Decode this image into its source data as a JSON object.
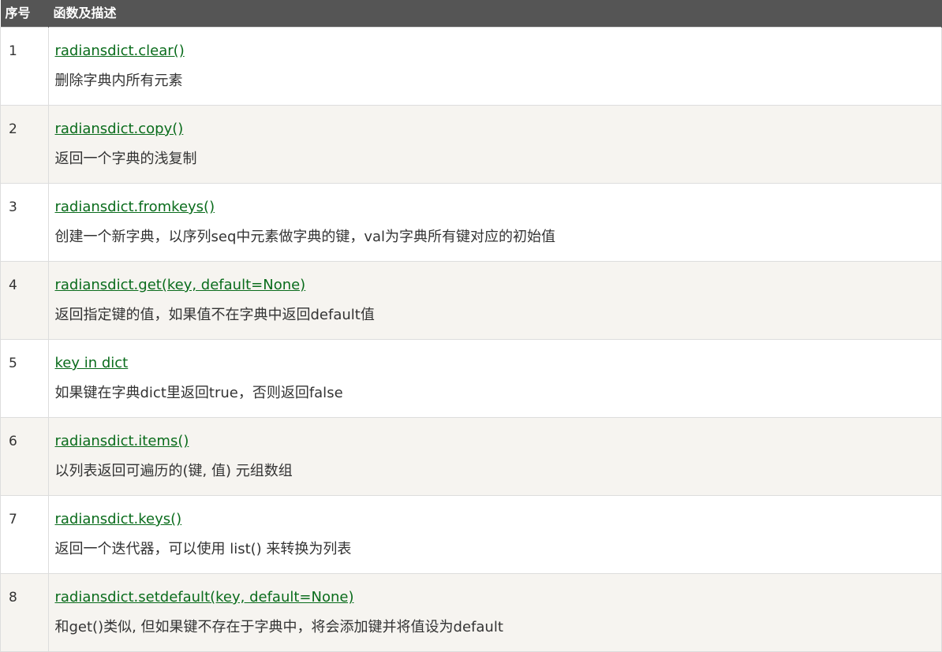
{
  "header": {
    "col_num": "序号",
    "col_desc": "函数及描述"
  },
  "rows": [
    {
      "num": "1",
      "func": "radiansdict.clear()",
      "desc": "删除字典内所有元素"
    },
    {
      "num": "2",
      "func": "radiansdict.copy()",
      "desc": "返回一个字典的浅复制"
    },
    {
      "num": "3",
      "func": "radiansdict.fromkeys()",
      "desc": "创建一个新字典，以序列seq中元素做字典的键，val为字典所有键对应的初始值"
    },
    {
      "num": "4",
      "func": "radiansdict.get(key, default=None)",
      "desc": "返回指定键的值，如果值不在字典中返回default值"
    },
    {
      "num": "5",
      "func": "key in dict",
      "desc": "如果键在字典dict里返回true，否则返回false"
    },
    {
      "num": "6",
      "func": "radiansdict.items()",
      "desc": "以列表返回可遍历的(键, 值) 元组数组"
    },
    {
      "num": "7",
      "func": "radiansdict.keys()",
      "desc": "返回一个迭代器，可以使用 list() 来转换为列表"
    },
    {
      "num": "8",
      "func": "radiansdict.setdefault(key, default=None)",
      "desc": "和get()类似, 但如果键不存在于字典中，将会添加键并将值设为default"
    }
  ],
  "colors": {
    "header_bg": "#555555",
    "link": "#0a6c1c",
    "row_alt_bg": "#f6f4f0"
  }
}
